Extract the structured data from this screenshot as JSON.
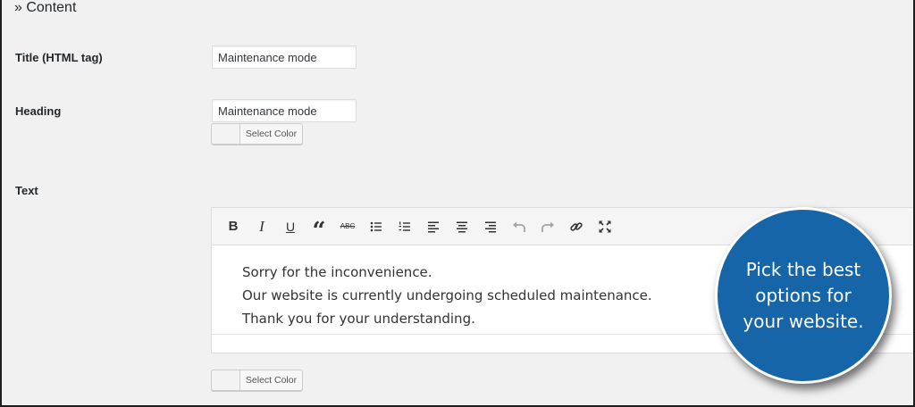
{
  "section": {
    "title": "» Content"
  },
  "fields": {
    "title": {
      "label": "Title (HTML tag)",
      "value": "Maintenance mode"
    },
    "heading": {
      "label": "Heading",
      "value": "Maintenance mode",
      "color_button": "Select Color"
    },
    "text": {
      "label": "Text",
      "content_lines": [
        "Sorry for the inconvenience.",
        "Our website is currently undergoing scheduled maintenance.",
        "Thank you for your understanding."
      ],
      "color_button": "Select Color"
    }
  },
  "toolbar": {
    "buttons": [
      "bold-icon",
      "italic-icon",
      "underline-icon",
      "blockquote-icon",
      "strikethrough-icon",
      "bullet-list-icon",
      "numbered-list-icon",
      "align-left-icon",
      "align-center-icon",
      "align-right-icon",
      "undo-icon",
      "redo-icon",
      "link-icon",
      "fullscreen-icon"
    ],
    "bold_glyph": "B",
    "italic_glyph": "I",
    "underline_glyph": "U",
    "quote_glyph": "“",
    "strike_glyph": "ABC"
  },
  "callout": {
    "text": "Pick the best options for your website.",
    "color": "#1565a8"
  }
}
